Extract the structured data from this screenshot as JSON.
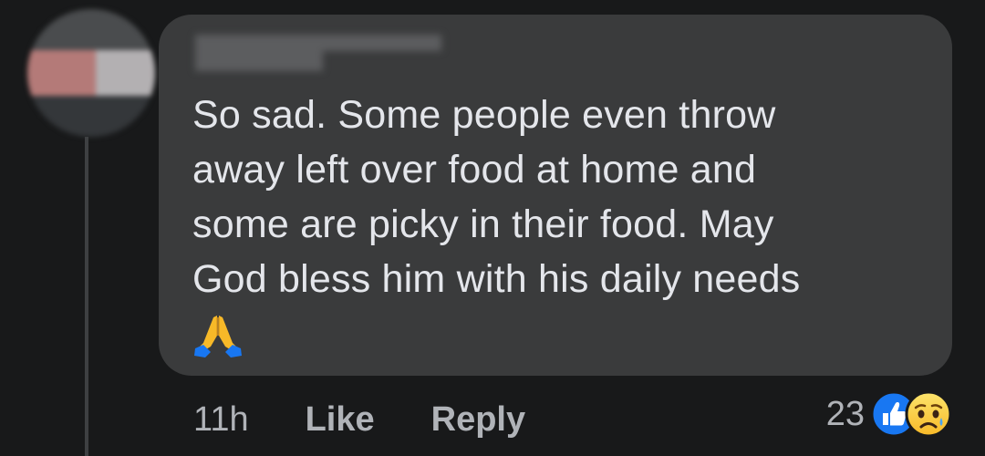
{
  "comment": {
    "lines": [
      "So sad. Some people even throw",
      "away left over food at home and",
      "some are picky in their food. May",
      "God bless him with his daily needs"
    ],
    "emoji": "🙏"
  },
  "actions": {
    "time": "11h",
    "like_label": "Like",
    "reply_label": "Reply"
  },
  "reactions": {
    "count": "23",
    "icons": [
      "like-reaction-icon",
      "sad-reaction-icon"
    ]
  },
  "colors": {
    "background": "#18191a",
    "bubble": "#3a3b3c",
    "text": "#e4e6eb",
    "secondary_text": "#b0b3b8",
    "like_blue": "#1877f2",
    "sad_yellow": "#f7b928"
  }
}
